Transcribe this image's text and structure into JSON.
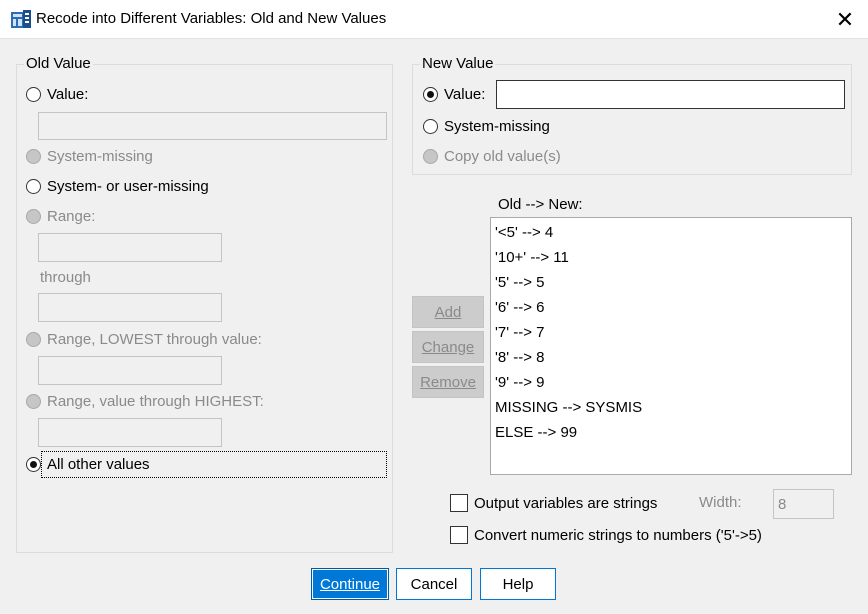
{
  "window": {
    "title": "Recode into Different Variables: Old and New Values",
    "close_symbol": "✕"
  },
  "old_value": {
    "legend": "Old Value",
    "value_label": "Value:",
    "system_missing_label": "System-missing",
    "system_or_user_missing_label": "System- or user-missing",
    "range_label": "Range:",
    "through_label": "through",
    "range_lowest_label": "Range, LOWEST through value:",
    "range_highest_label": "Range, value through HIGHEST:",
    "all_other_label": "All other values",
    "selected": "all_other"
  },
  "new_value": {
    "legend": "New Value",
    "value_label": "Value:",
    "value_input": "",
    "system_missing_label": "System-missing",
    "copy_old_label": "Copy old value(s)",
    "selected": "value"
  },
  "mapping": {
    "header": "Old --> New:",
    "items": [
      "'<5' --> 4",
      "'10+' --> 11",
      "'5' --> 5",
      "'6' --> 6",
      "'7' --> 7",
      "'8' --> 8",
      "'9' --> 9",
      "MISSING --> SYSMIS",
      "ELSE --> 99"
    ],
    "add_label": "Add",
    "change_label": "Change",
    "remove_label": "Remove"
  },
  "options": {
    "output_strings_label": "Output variables are strings",
    "output_strings_checked": false,
    "width_label": "Width:",
    "width_value": "8",
    "convert_numeric_label": "Convert numeric strings to numbers ('5'->5)",
    "convert_numeric_checked": false
  },
  "footer": {
    "continue_label": "Continue",
    "cancel_label": "Cancel",
    "help_label": "Help"
  },
  "colors": {
    "accent": "#0078d7",
    "disabled_text": "#8a8a8a",
    "dialog_bg": "#f0f0f0"
  }
}
